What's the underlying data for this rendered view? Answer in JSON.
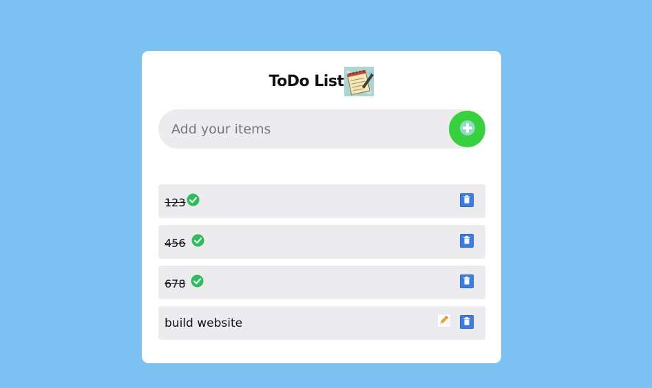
{
  "header": {
    "title": "ToDo List",
    "icon": "notepad-icon"
  },
  "input": {
    "placeholder": "Add your items",
    "value": ""
  },
  "add_button": {
    "icon": "plus-circle-icon"
  },
  "items": [
    {
      "text": "123",
      "completed": true
    },
    {
      "text": "456",
      "completed": true
    },
    {
      "text": "678",
      "completed": true
    },
    {
      "text": "build website",
      "completed": false
    }
  ],
  "colors": {
    "background": "#7bc2f3",
    "card": "#ffffff",
    "row": "#ececee",
    "add_button": "#36d13d",
    "check": "#2ebd5b",
    "delete": "#3b7de0"
  }
}
